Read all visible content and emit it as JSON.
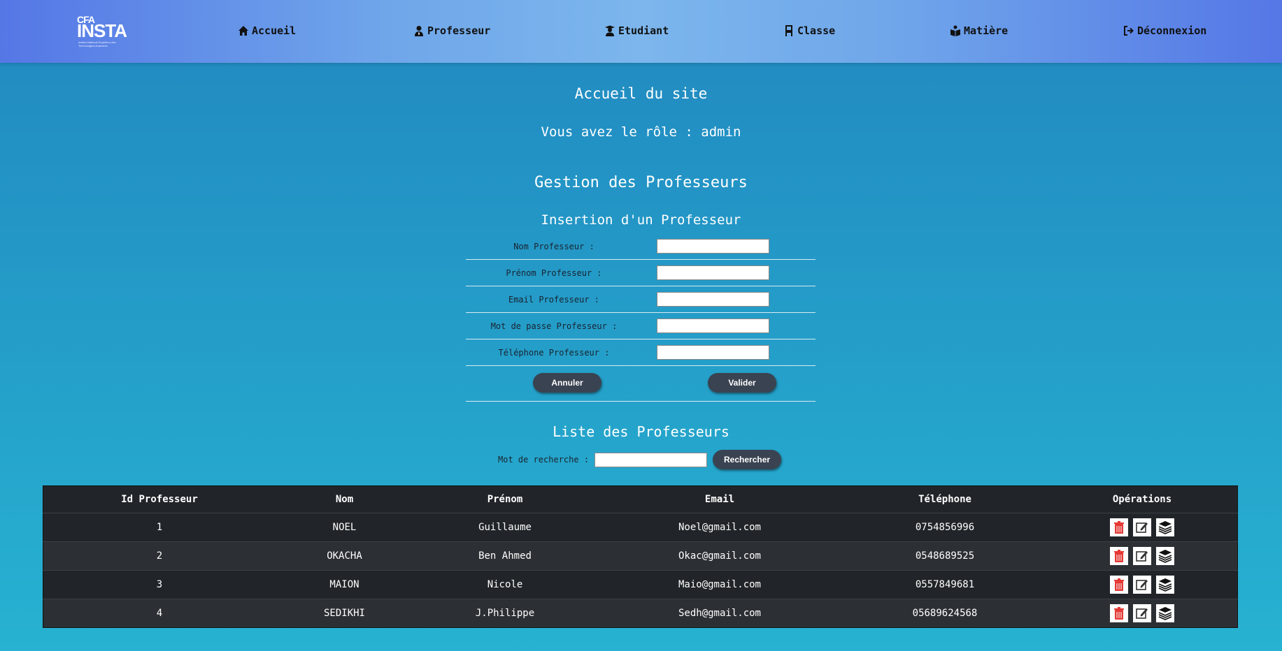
{
  "logo": {
    "top": "CFA",
    "main": "INSTA",
    "sub": "Institut National Supérieur des Technologies Avancées"
  },
  "nav": [
    {
      "label": "Accueil",
      "icon": "home-icon"
    },
    {
      "label": "Professeur",
      "icon": "user-tie-icon"
    },
    {
      "label": "Etudiant",
      "icon": "user-graduate-icon"
    },
    {
      "label": "Classe",
      "icon": "chair-icon"
    },
    {
      "label": "Matière",
      "icon": "book-reader-icon"
    },
    {
      "label": "Déconnexion",
      "icon": "sign-out-icon"
    }
  ],
  "header": {
    "welcome": "Accueil du site",
    "role": "Vous avez le rôle : admin"
  },
  "section": {
    "title": "Gestion des Professeurs",
    "insert_title": "Insertion d'un Professeur",
    "list_title": "Liste des Professeurs"
  },
  "form": {
    "fields": [
      {
        "label": "Nom Professeur :",
        "value": ""
      },
      {
        "label": "Prénom Professeur :",
        "value": ""
      },
      {
        "label": "Email Professeur :",
        "value": ""
      },
      {
        "label": "Mot de passe Professeur :",
        "value": ""
      },
      {
        "label": "Téléphone Professeur :",
        "value": ""
      }
    ],
    "cancel_label": "Annuler",
    "submit_label": "Valider"
  },
  "search": {
    "label": "Mot de recherche :",
    "value": "",
    "button_label": "Rechercher"
  },
  "table": {
    "headers": [
      "Id Professeur",
      "Nom",
      "Prénom",
      "Email",
      "Téléphone",
      "Opérations"
    ],
    "rows": [
      {
        "id": "1",
        "nom": "NOEL",
        "prenom": "Guillaume",
        "email": "Noel@gmail.com",
        "tel": "0754856996"
      },
      {
        "id": "2",
        "nom": "OKACHA",
        "prenom": "Ben Ahmed",
        "email": "Okac@gmail.com",
        "tel": "0548689525"
      },
      {
        "id": "3",
        "nom": "MAION",
        "prenom": "Nicole",
        "email": "Maio@gmail.com",
        "tel": "0557849681"
      },
      {
        "id": "4",
        "nom": "SEDIKHI",
        "prenom": "J.Philippe",
        "email": "Sedh@gmail.com",
        "tel": "05689624568"
      }
    ],
    "operation_icons": [
      "trash-icon",
      "edit-icon",
      "stack-icon"
    ]
  },
  "colors": {
    "nav_gradient_edge": "#5577e6",
    "nav_gradient_center": "#7cb6ec",
    "table_bg": "#212529",
    "button_bg": "#3a4351",
    "trash_red": "#e53935"
  }
}
